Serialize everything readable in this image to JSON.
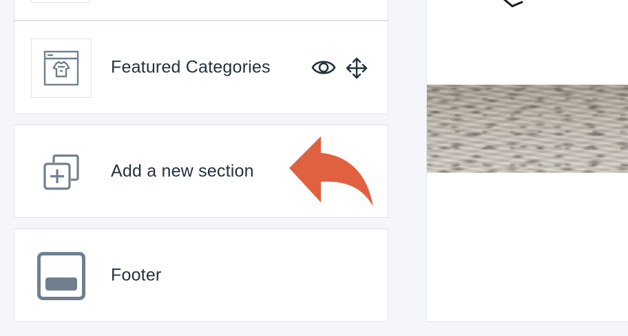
{
  "sections": {
    "featured": {
      "label": "Featured Categories",
      "thumbnail_icon": "storefront-shirt-icon",
      "visibility_icon": "eye-icon",
      "drag_icon": "move-arrows-icon"
    },
    "add_section": {
      "label": "Add a new section",
      "icon": "add-copy-icon"
    },
    "footer": {
      "label": "Footer",
      "icon": "footer-layout-icon"
    }
  },
  "annotation": {
    "arrow_icon": "curved-arrow-icon",
    "arrow_color": "#e0613f"
  },
  "colors": {
    "text": "#22303f",
    "icon": "#6f7f8d",
    "border": "#dde3ec",
    "background": "#f4f6fa"
  }
}
